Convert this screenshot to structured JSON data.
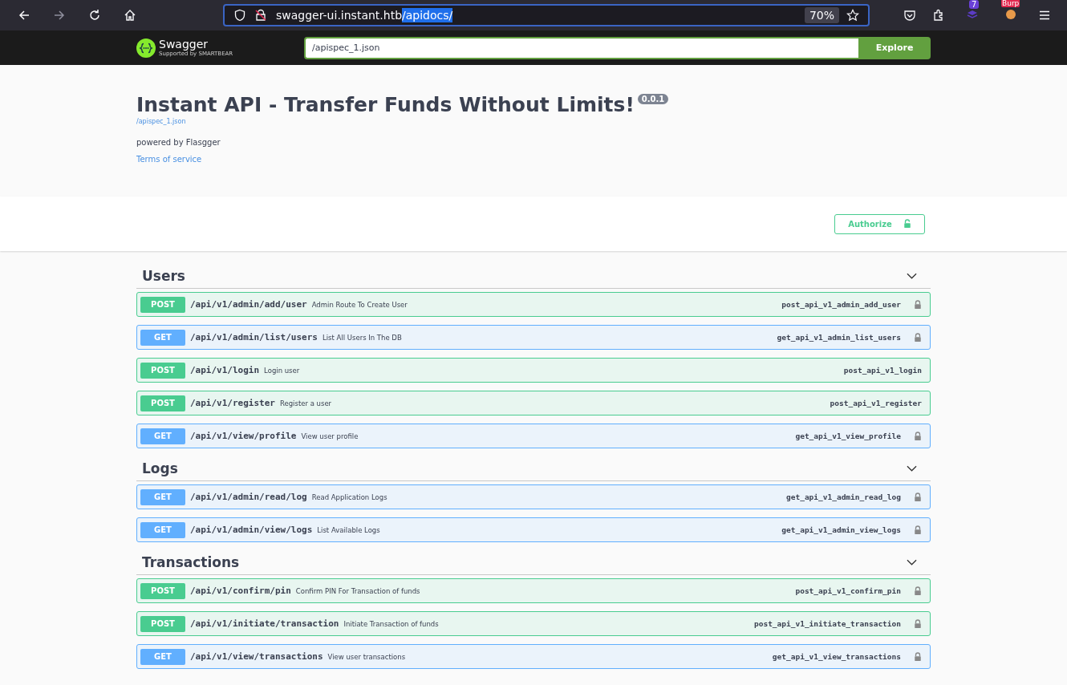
{
  "browser": {
    "url_host": "swagger-ui.instant.htb",
    "url_selected": "/apidocs/",
    "zoom": "70%",
    "forward_disabled": true,
    "extension_badge": "7",
    "burp_badge": "Burp"
  },
  "topbar": {
    "logo_text": "Swagger",
    "logo_sub": "Supported by SMARTBEAR",
    "spec_url": "/apispec_1.json",
    "explore": "Explore"
  },
  "info": {
    "title": "Instant API - Transfer Funds Without Limits!",
    "version": "0.0.1",
    "spec_link": "/apispec_1.json",
    "description": "powered by Flasgger",
    "terms": "Terms of service"
  },
  "authorize": "Authorize",
  "sections": [
    {
      "name": "Users",
      "expanded": true,
      "operations": [
        {
          "method": "POST",
          "path": "/api/v1/admin/add/user",
          "summary": "Admin Route To Create User",
          "operation_id": "post_api_v1_admin_add_user",
          "locked": true
        },
        {
          "method": "GET",
          "path": "/api/v1/admin/list/users",
          "summary": "List All Users In The DB",
          "operation_id": "get_api_v1_admin_list_users",
          "locked": true
        },
        {
          "method": "POST",
          "path": "/api/v1/login",
          "summary": "Login user",
          "operation_id": "post_api_v1_login",
          "locked": false
        },
        {
          "method": "POST",
          "path": "/api/v1/register",
          "summary": "Register a user",
          "operation_id": "post_api_v1_register",
          "locked": false
        },
        {
          "method": "GET",
          "path": "/api/v1/view/profile",
          "summary": "View user profile",
          "operation_id": "get_api_v1_view_profile",
          "locked": true
        }
      ]
    },
    {
      "name": "Logs",
      "expanded": true,
      "operations": [
        {
          "method": "GET",
          "path": "/api/v1/admin/read/log",
          "summary": "Read Application Logs",
          "operation_id": "get_api_v1_admin_read_log",
          "locked": true
        },
        {
          "method": "GET",
          "path": "/api/v1/admin/view/logs",
          "summary": "List Available Logs",
          "operation_id": "get_api_v1_admin_view_logs",
          "locked": true
        }
      ]
    },
    {
      "name": "Transactions",
      "expanded": true,
      "operations": [
        {
          "method": "POST",
          "path": "/api/v1/confirm/pin",
          "summary": "Confirm PIN For Transaction of funds",
          "operation_id": "post_api_v1_confirm_pin",
          "locked": true
        },
        {
          "method": "POST",
          "path": "/api/v1/initiate/transaction",
          "summary": "Initiate Transaction of funds",
          "operation_id": "post_api_v1_initiate_transaction",
          "locked": true
        },
        {
          "method": "GET",
          "path": "/api/v1/view/transactions",
          "summary": "View user transactions",
          "operation_id": "get_api_v1_view_transactions",
          "locked": true
        }
      ]
    }
  ]
}
